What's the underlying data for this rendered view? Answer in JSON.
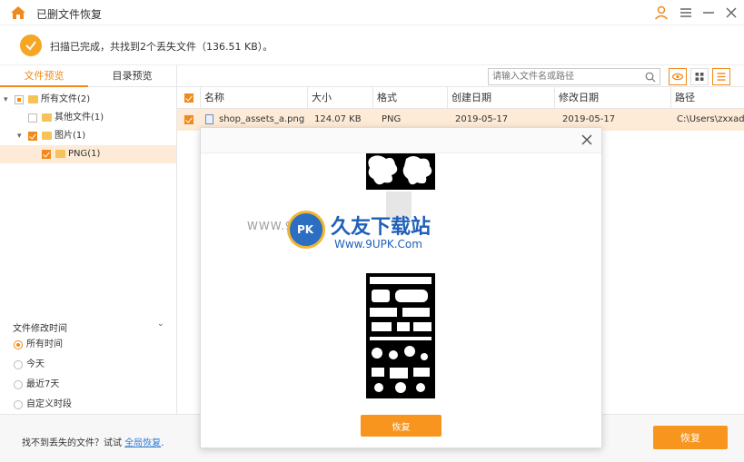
{
  "app": {
    "title": "已删文件恢复"
  },
  "status": {
    "text": "扫描已完成，共找到2个丢失文件（136.51 KB）。"
  },
  "left_tabs": [
    {
      "label": "文件预览"
    },
    {
      "label": "目录预览"
    }
  ],
  "tree": [
    {
      "label": "所有文件(2)"
    },
    {
      "label": "其他文件(1)"
    },
    {
      "label": "图片(1)"
    },
    {
      "label": "PNG(1)"
    }
  ],
  "filter": {
    "title": "文件修改时间",
    "options": [
      {
        "label": "所有时间"
      },
      {
        "label": "今天"
      },
      {
        "label": "最近7天"
      },
      {
        "label": "自定义时段"
      }
    ]
  },
  "search": {
    "placeholder": "请输入文件名或路径"
  },
  "table": {
    "columns": [
      "名称",
      "大小",
      "格式",
      "创建日期",
      "修改日期",
      "路径"
    ],
    "rows": [
      {
        "name": "shop_assets_a.png",
        "size": "124.07 KB",
        "format": "PNG",
        "created": "2019-05-17",
        "modified": "2019-05-17",
        "path": "C:\\Users\\zxxad..."
      }
    ]
  },
  "bottom": {
    "hint": "找不到丢失的文件？试试",
    "link": "全局恢复",
    "link_suffix": ".",
    "recover": "恢复"
  },
  "preview": {
    "recover": "恢复"
  },
  "watermark": {
    "small": "WWW.9U",
    "logo": "PK",
    "big": "久友下载站",
    "url": "Www.9UPK.Com"
  },
  "colors": {
    "accent": "#f7951e",
    "selection": "#fdebd7",
    "link": "#2e7cd6"
  }
}
